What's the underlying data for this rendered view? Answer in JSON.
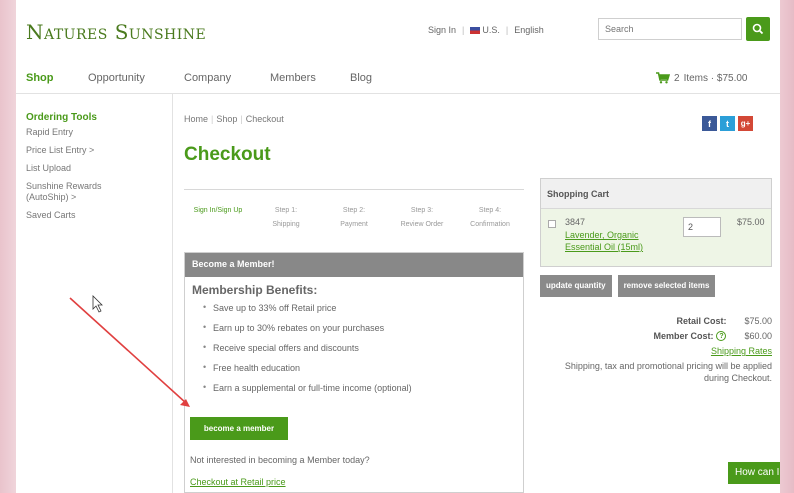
{
  "header": {
    "logo": "Natures Sunshine",
    "sign_in": "Sign In",
    "country": "U.S.",
    "language": "English",
    "search_placeholder": "Search"
  },
  "nav": {
    "items": [
      "Shop",
      "Opportunity",
      "Company",
      "Members",
      "Blog"
    ],
    "cart_count": "2",
    "cart_text": "Items · $75.00"
  },
  "sidebar": {
    "heading": "Ordering Tools",
    "items": [
      "Rapid Entry",
      "Price List Entry >",
      "List Upload",
      "Sunshine Rewards (AutoShip) >",
      "Saved Carts"
    ]
  },
  "breadcrumb": [
    "Home",
    "Shop",
    "Checkout"
  ],
  "page_title": "Checkout",
  "social": [
    "f",
    "t",
    "g+"
  ],
  "steps": [
    {
      "line1": "Sign In/Sign Up",
      "line2": ""
    },
    {
      "line1": "Step 1:",
      "line2": "Shipping"
    },
    {
      "line1": "Step 2:",
      "line2": "Payment"
    },
    {
      "line1": "Step 3:",
      "line2": "Review Order"
    },
    {
      "line1": "Step 4:",
      "line2": "Confirmation"
    }
  ],
  "member": {
    "header": "Become a Member!",
    "subtitle": "Membership Benefits:",
    "benefits": [
      "Save up to 33% off Retail price",
      "Earn up to 30% rebates on your purchases",
      "Receive special offers and discounts",
      "Free health education",
      "Earn a supplemental or full-time income (optional)"
    ],
    "button": "become a member",
    "not_interested": "Not interested in becoming a Member today?",
    "retail_link": "Checkout at Retail price"
  },
  "cart": {
    "header": "Shopping Cart",
    "item": {
      "sku": "3847",
      "name": "Lavender, Organic Essential Oil (15ml)",
      "qty": "2",
      "price": "$75.00"
    },
    "update_btn": "update quantity",
    "remove_btn": "remove selected items",
    "retail_label": "Retail Cost:",
    "retail_value": "$75.00",
    "member_label": "Member Cost:",
    "member_value": "$60.00",
    "shipping_link": "Shipping Rates",
    "note": "Shipping, tax and promotional pricing will be applied during Checkout."
  },
  "chat": "How can I help",
  "colors": {
    "brand_green": "#4a9a1a",
    "gray_header": "#888888",
    "annotation_arrow": "#e04040"
  }
}
